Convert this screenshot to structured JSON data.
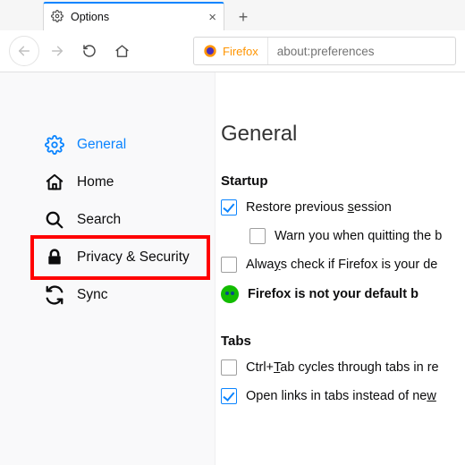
{
  "tab": {
    "title": "Options"
  },
  "url_bar": {
    "identity": "Firefox",
    "url": "about:preferences"
  },
  "sidebar": {
    "items": [
      {
        "label": "General"
      },
      {
        "label": "Home"
      },
      {
        "label": "Search"
      },
      {
        "label": "Privacy & Security"
      },
      {
        "label": "Sync"
      }
    ]
  },
  "main": {
    "title": "General",
    "startup": {
      "heading": "Startup",
      "restore_label_pre": "Restore previous ",
      "restore_label_u": "s",
      "restore_label_post": "ession",
      "warn_quit_label": "Warn you when quitting the b",
      "always_check_pre": "Alwa",
      "always_check_u": "y",
      "always_check_post": "s check if Firefox is your de",
      "not_default_label": "Firefox is not your default b"
    },
    "tabs": {
      "heading": "Tabs",
      "ctrl_tab_pre": "Ctrl+",
      "ctrl_tab_u": "T",
      "ctrl_tab_post": "ab cycles through tabs in re",
      "open_links_pre": "Open links in tabs instead of ne",
      "open_links_u": "w"
    }
  }
}
